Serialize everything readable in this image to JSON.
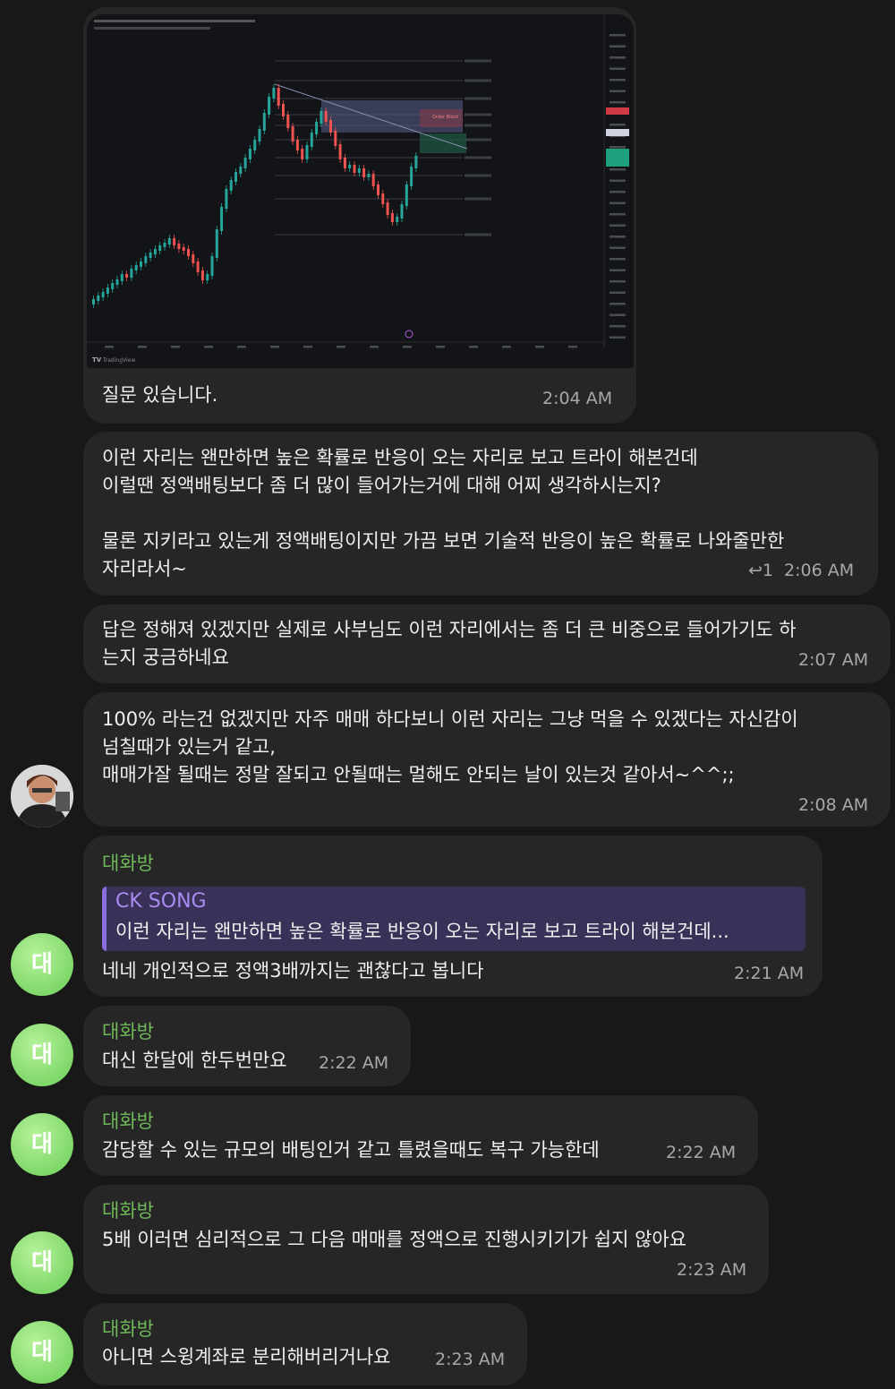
{
  "chart_message": {
    "text": "질문 있습니다.",
    "time": "2:04 AM",
    "chart_brand": "TradingView",
    "order_block_label": "Order Block"
  },
  "msg1": {
    "line1": "이런 자리는 왠만하면 높은 확률로 반응이 오는 자리로 보고 트라이 해본건데",
    "line2": "이럴땐 정액배팅보다 좀 더 많이 들어가는거에 대해 어찌 생각하시는지?",
    "line3": "물론 지키라고 있는게 정액배팅이지만 가끔 보면 기술적 반응이 높은 확률로 나와줄만한",
    "line4": "자리라서~",
    "reply_count": "1",
    "time": "2:06 AM"
  },
  "msg2": {
    "line1": "답은 정해져 있겠지만 실제로 사부님도 이런 자리에서는 좀 더 큰 비중으로 들어가기도 하",
    "line2": "는지 궁금하네요",
    "time": "2:07 AM"
  },
  "msg3": {
    "line1": "100% 라는건 없겠지만 자주 매매 하다보니 이런 자리는 그냥 먹을 수 있겠다는 자신감이",
    "line2": "넘칠때가 있는거 같고,",
    "line3": "매매가잘 될때는 정말 잘되고 안될때는 멀해도 안되는 날이 있는것 같아서~^^;;",
    "time": "2:08 AM"
  },
  "msg4": {
    "sender": "대화방",
    "reply_name": "CK SONG",
    "reply_text": "이런 자리는 왠만하면 높은 확률로 반응이 오는 자리로 보고 트라이 해본건데...",
    "text": "네네 개인적으로 정액3배까지는 괜찮다고 봅니다",
    "time": "2:21 AM",
    "avatar": "대"
  },
  "msg5": {
    "sender": "대화방",
    "text": "대신 한달에 한두번만요",
    "time": "2:22 AM",
    "avatar": "대"
  },
  "msg6": {
    "sender": "대화방",
    "text": "감당할 수 있는 규모의 배팅인거 같고 틀렸을때도 복구 가능한데",
    "time": "2:22 AM",
    "avatar": "대"
  },
  "msg7": {
    "sender": "대화방",
    "text": "5배 이러면 심리적으로 그 다음 매매를 정액으로 진행시키기가 쉽지 않아요",
    "time": "2:23 AM",
    "avatar": "대"
  },
  "msg8": {
    "sender": "대화방",
    "text": "아니면 스윙계좌로 분리해버리거나요",
    "time": "2:23 AM",
    "avatar": "대"
  },
  "colors": {
    "bg": "#181818",
    "bubble": "#262626",
    "sender": "#6fb85a",
    "reply_accent": "#8b6ee0",
    "candle_up": "#26a69a",
    "candle_down": "#ef5350"
  }
}
